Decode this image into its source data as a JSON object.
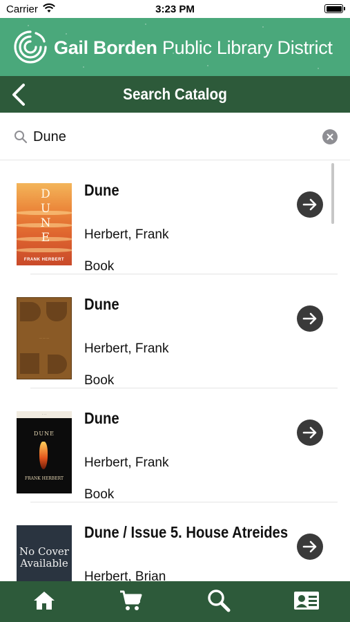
{
  "status_bar": {
    "carrier": "Carrier",
    "time": "3:23 PM"
  },
  "brand": {
    "name_bold": "Gail Borden",
    "name_rest": "Public Library District",
    "color": "#4aa87b"
  },
  "header": {
    "title": "Search Catalog",
    "back_icon": "chevron-left-icon",
    "color": "#2d5a3a"
  },
  "search": {
    "value": "Dune",
    "search_icon": "search-icon",
    "clear_icon": "clear-circle-icon"
  },
  "results": [
    {
      "title": "Dune",
      "author": "Herbert, Frank",
      "format": "Book",
      "cover": {
        "word": "DUNE",
        "author": "FRANK HERBERT"
      }
    },
    {
      "title": "Dune",
      "author": "Herbert, Frank",
      "format": "Book",
      "cover": {}
    },
    {
      "title": "Dune",
      "author": "Herbert, Frank",
      "format": "Book",
      "cover": {
        "word": "DUNE",
        "author": "FRANK HERBERT"
      }
    },
    {
      "title": "Dune / Issue 5. House Atreides",
      "author": "Herbert, Brian",
      "format": "",
      "cover": {
        "placeholder": "No Cover Available"
      }
    }
  ],
  "tabs": [
    {
      "name": "home",
      "icon": "home-icon"
    },
    {
      "name": "cart",
      "icon": "cart-icon"
    },
    {
      "name": "search",
      "icon": "search-icon"
    },
    {
      "name": "account",
      "icon": "library-card-icon"
    }
  ]
}
